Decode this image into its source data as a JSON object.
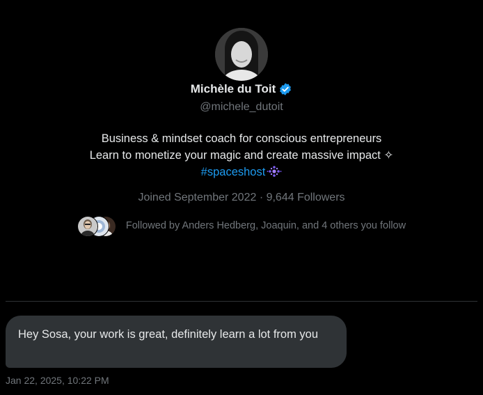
{
  "profile": {
    "display_name": "Michèle du Toit",
    "verified_icon": "verified-badge-icon",
    "handle": "@michele_dutoit",
    "bio_line1": "Business & mindset coach for conscious entrepreneurs",
    "bio_line2": "Learn to monetize your magic and create massive impact ✧",
    "hashtag": "#spaceshost",
    "joined": "Joined September 2022 · 9,644 Followers",
    "followed_by": "Followed by Anders Hedberg, Joaquin, and 4 others you follow"
  },
  "conversation": {
    "message": "Hey Sosa, your work is great, definitely learn a lot from you",
    "timestamp": "Jan 22, 2025, 10:22 PM"
  },
  "colors": {
    "background": "#000000",
    "primary_text": "#e7e9ea",
    "secondary_text": "#71767b",
    "accent_blue": "#1d9bf0",
    "bubble": "#2f3336",
    "divider": "#2f3336"
  }
}
